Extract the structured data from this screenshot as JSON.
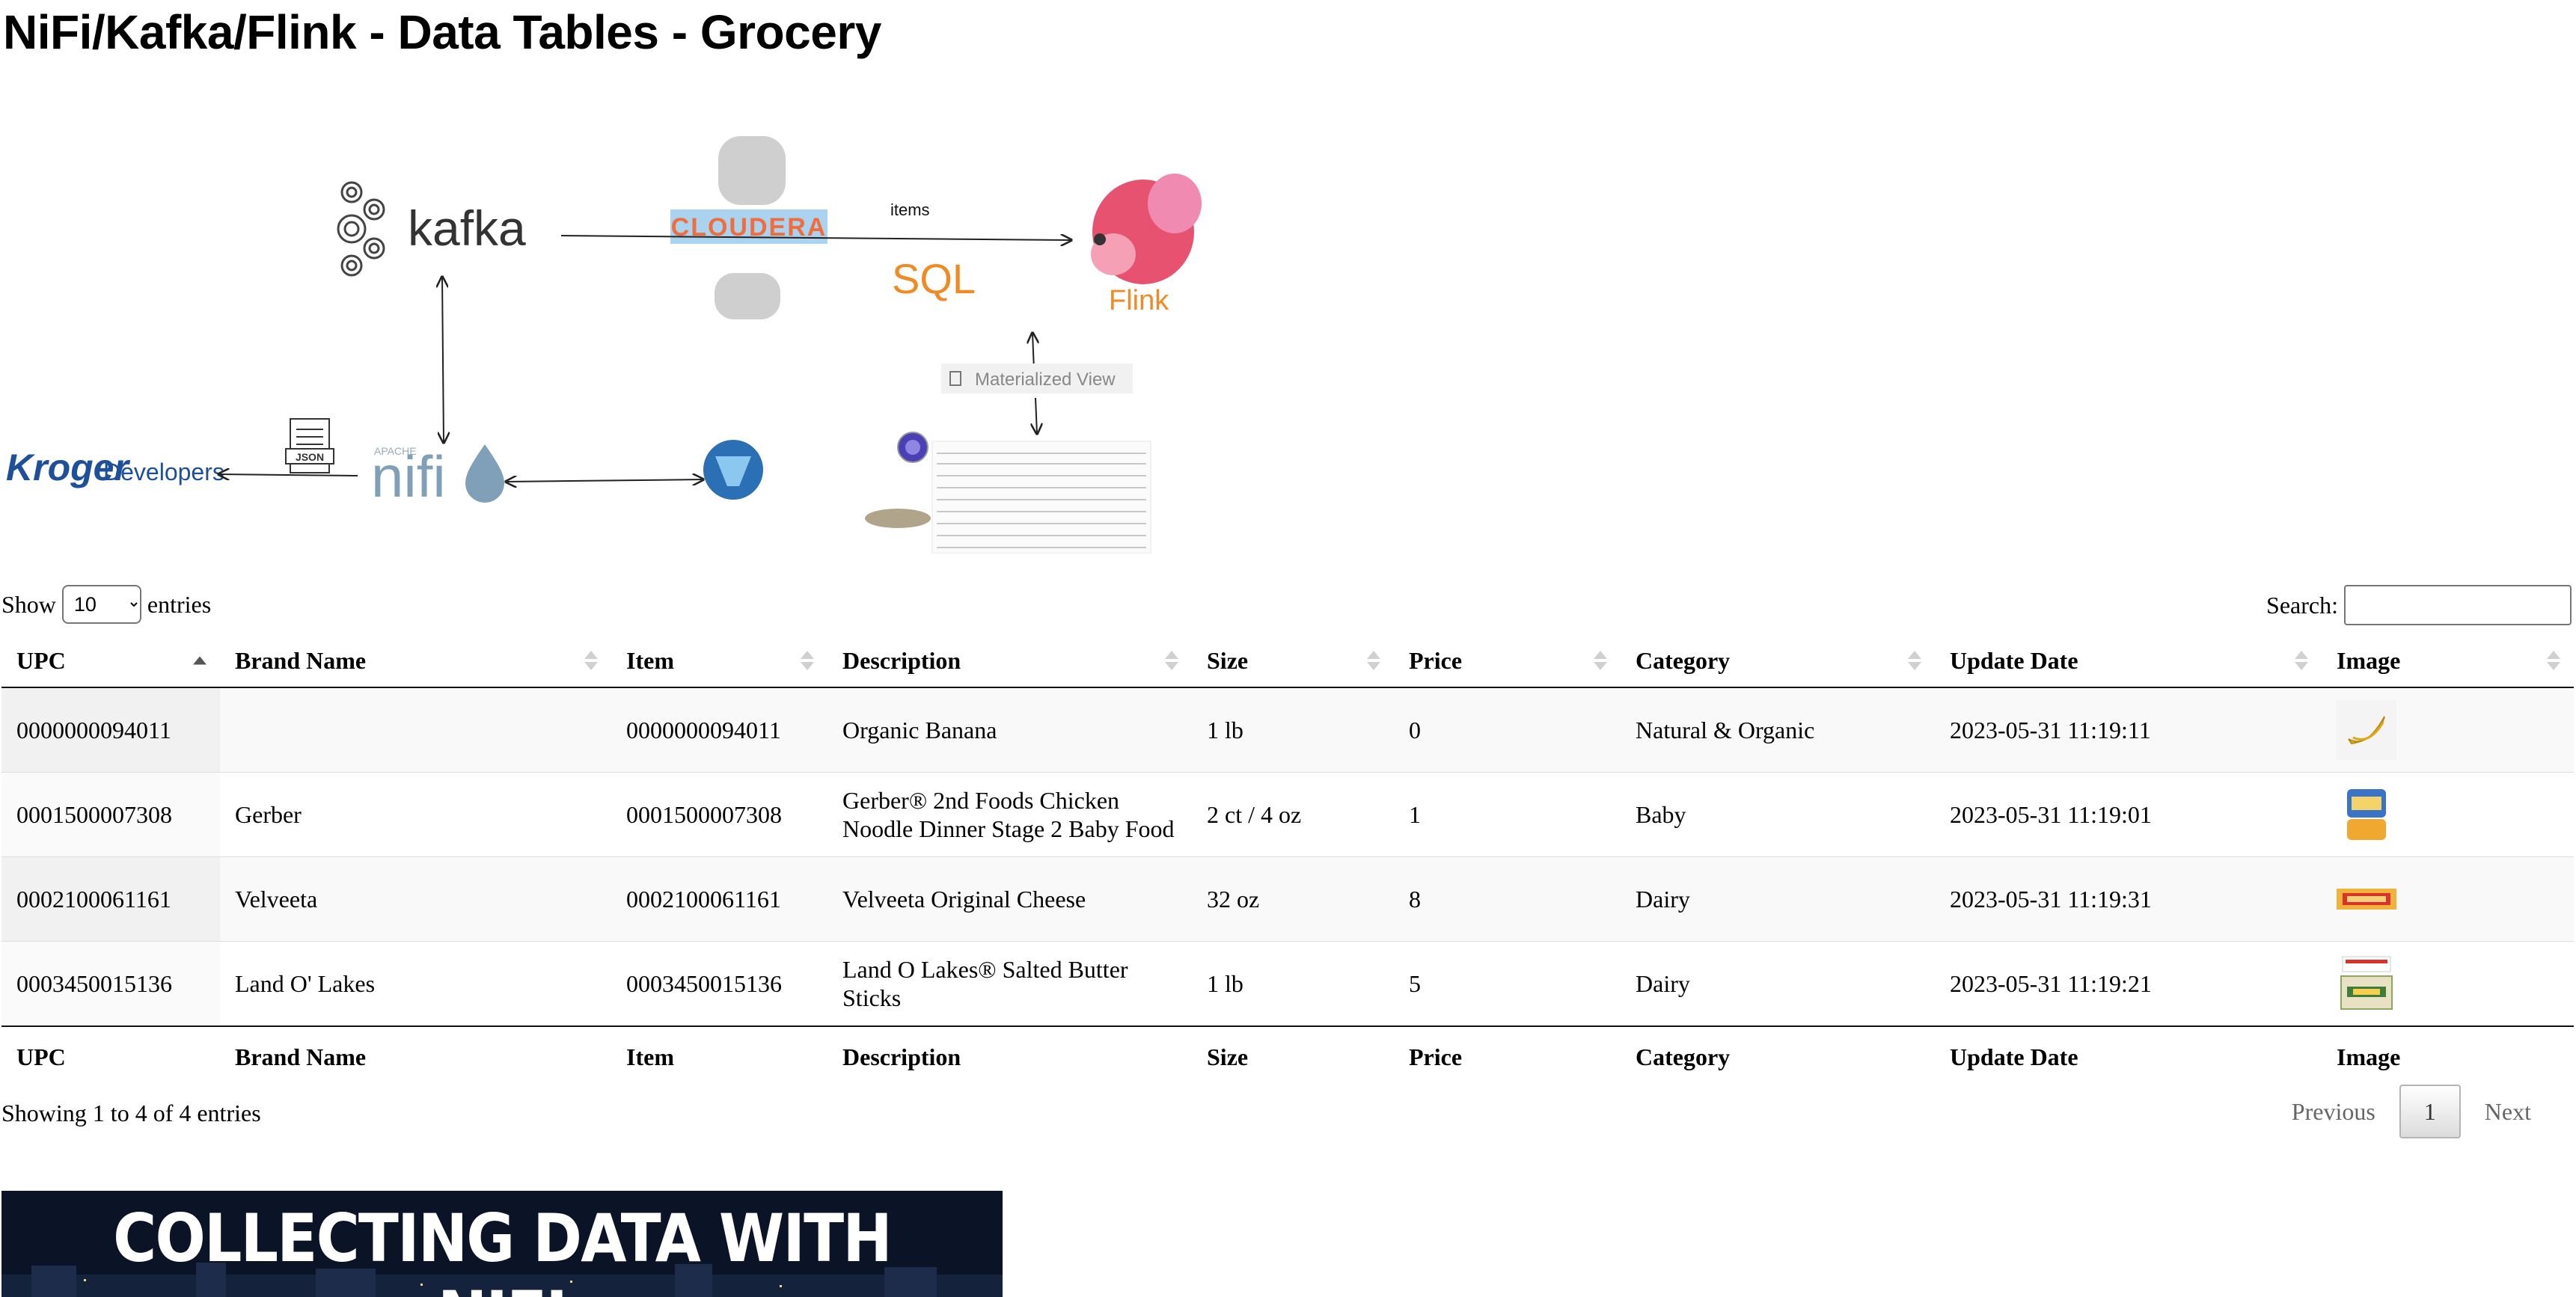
{
  "page": {
    "title": "NiFi/Kafka/Flink - Data Tables - Grocery"
  },
  "diagram": {
    "labels": {
      "kafka": "kafka",
      "cloudera": "CLOUDERA",
      "items": "items",
      "sql": "SQL",
      "flink": "Flink",
      "materialized_view": "Materialized View",
      "kroger": "Kroger",
      "developers": "Developers",
      "nifi_top": "APACHE",
      "nifi": "nifi",
      "json": "JSON"
    },
    "colors": {
      "cloudera": "#f26d3d",
      "sql": "#f08a24",
      "flink": "#e6526f",
      "kroger": "#1d4f9a",
      "nifi": "#7fa0b8"
    }
  },
  "controls": {
    "show_label": "Show",
    "entries_label": "entries",
    "length_value": "10",
    "search_label": "Search:",
    "search_value": ""
  },
  "table": {
    "columns": [
      "UPC",
      "Brand Name",
      "Item",
      "Description",
      "Size",
      "Price",
      "Category",
      "Update Date",
      "Image"
    ],
    "rows": [
      {
        "upc": "0000000094011",
        "brand": "",
        "item": "0000000094011",
        "description": "Organic Banana",
        "size": "1 lb",
        "price": "0",
        "category": "Natural & Organic",
        "update_date": "2023-05-31 11:19:11",
        "image": "banana-image"
      },
      {
        "upc": "0001500007308",
        "brand": "Gerber",
        "item": "0001500007308",
        "description": "Gerber® 2nd Foods Chicken Noodle Dinner Stage 2 Baby Food",
        "size": "2 ct / 4 oz",
        "price": "1",
        "category": "Baby",
        "update_date": "2023-05-31 11:19:01",
        "image": "baby-food-image"
      },
      {
        "upc": "0002100061161",
        "brand": "Velveeta",
        "item": "0002100061161",
        "description": "Velveeta Original Cheese",
        "size": "32 oz",
        "price": "8",
        "category": "Dairy",
        "update_date": "2023-05-31 11:19:31",
        "image": "cheese-image"
      },
      {
        "upc": "0003450015136",
        "brand": "Land O' Lakes",
        "item": "0003450015136",
        "description": "Land O Lakes® Salted Butter Sticks",
        "size": "1 lb",
        "price": "5",
        "category": "Dairy",
        "update_date": "2023-05-31 11:19:21",
        "image": "butter-image"
      }
    ]
  },
  "footer": {
    "info": "Showing 1 to 4 of 4 entries",
    "previous": "Previous",
    "current_page": "1",
    "next": "Next"
  },
  "banner": {
    "text": "COLLECTING DATA WITH NIFI"
  }
}
